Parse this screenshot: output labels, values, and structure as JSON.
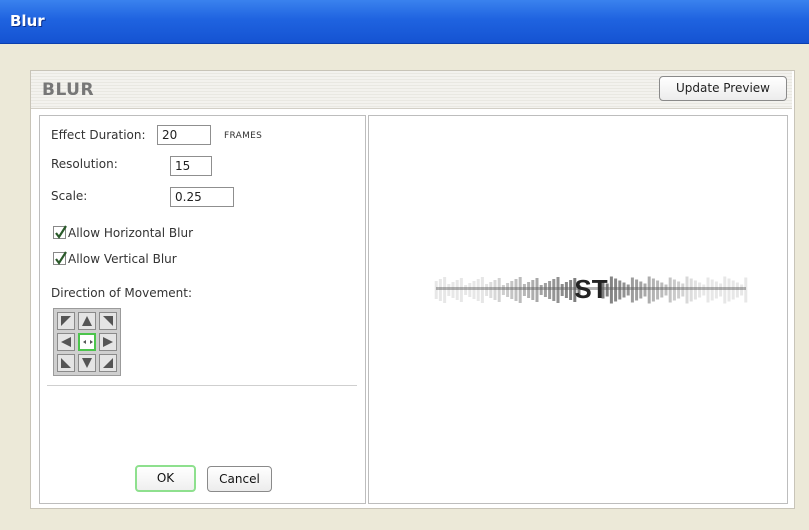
{
  "window": {
    "title": "Blur"
  },
  "panel": {
    "title": "BLUR",
    "update_preview": "Update Preview"
  },
  "settings": {
    "effect_duration": {
      "label": "Effect Duration:",
      "value": "20",
      "unit": "FRAMES"
    },
    "resolution": {
      "label": "Resolution:",
      "value": "15"
    },
    "scale": {
      "label": "Scale:",
      "value": "0.25"
    },
    "allow_horizontal": {
      "label": "Allow Horizontal Blur",
      "checked": true
    },
    "allow_vertical": {
      "label": "Allow Vertical Blur",
      "checked": true
    },
    "direction": {
      "label": "Direction of Movement:",
      "selected": "center"
    }
  },
  "buttons": {
    "ok": "OK",
    "cancel": "Cancel"
  },
  "preview": {
    "text": "ST"
  },
  "colors": {
    "title_bar": "#1f63e0",
    "selected_direction": "#4cc44c"
  }
}
